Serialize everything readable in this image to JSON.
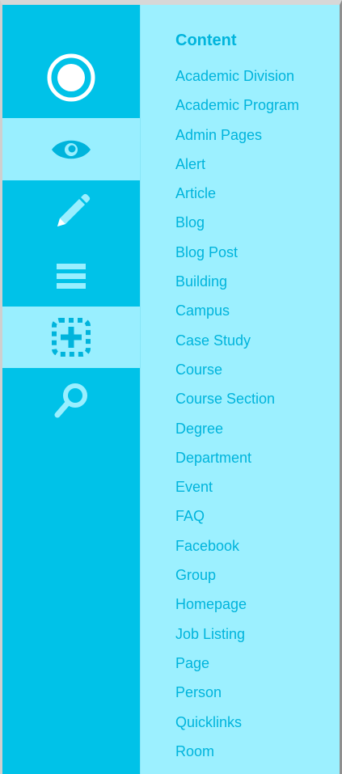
{
  "colors": {
    "rail_bg": "#00c2e8",
    "rail_active_bg": "#99efff",
    "panel_bg": "#9cf0ff",
    "text": "#00b4dc",
    "icon_light": "#ffffff",
    "icon_dark": "#00b4dc"
  },
  "rail": {
    "items": [
      {
        "name": "workbench",
        "icon": "circle-dot-icon",
        "active": false
      },
      {
        "name": "view",
        "icon": "eye-icon",
        "active": true
      },
      {
        "name": "edit",
        "icon": "pencil-icon",
        "active": false
      },
      {
        "name": "menu",
        "icon": "hamburger-icon",
        "active": false
      },
      {
        "name": "add",
        "icon": "dashed-plus-icon",
        "active": true
      },
      {
        "name": "search",
        "icon": "magnifier-icon",
        "active": false
      }
    ]
  },
  "panel": {
    "title": "Content",
    "items": [
      "Academic Division",
      "Academic Program",
      "Admin Pages",
      "Alert",
      "Article",
      "Blog",
      "Blog Post",
      "Building",
      "Campus",
      "Case Study",
      "Course",
      "Course Section",
      "Degree",
      "Department",
      "Event",
      "FAQ",
      "Facebook",
      "Group",
      "Homepage",
      "Job Listing",
      "Page",
      "Person",
      "Quicklinks",
      "Room"
    ]
  }
}
